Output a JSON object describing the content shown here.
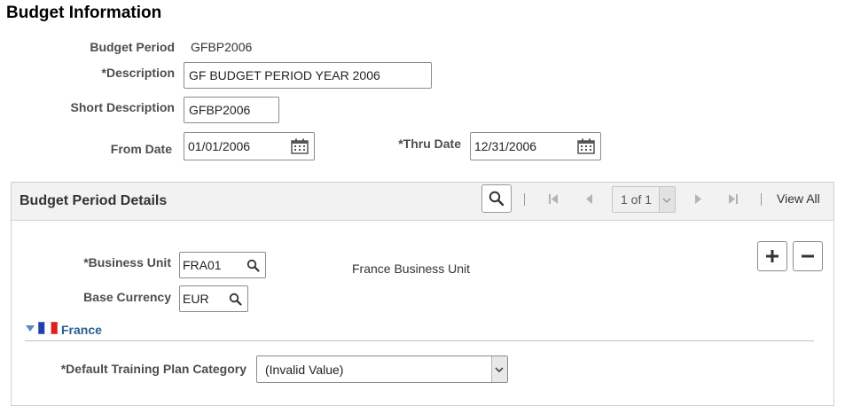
{
  "page": {
    "title": "Budget Information"
  },
  "form": {
    "budget_period_label": "Budget Period",
    "budget_period_value": "GFBP2006",
    "description_label": "*Description",
    "description_value": "GF BUDGET PERIOD YEAR 2006",
    "short_description_label": "Short Description",
    "short_description_value": "GFBP2006",
    "from_date_label": "From Date",
    "from_date_value": "01/01/2006",
    "thru_date_label": "*Thru Date",
    "thru_date_value": "12/31/2006"
  },
  "grid": {
    "title": "Budget Period Details",
    "pager_text": "1 of 1",
    "view_all": "View All",
    "business_unit_label": "*Business Unit",
    "business_unit_value": "FRA01",
    "business_unit_desc": "France Business Unit",
    "base_currency_label": "Base Currency",
    "base_currency_value": "EUR",
    "country_section": "France",
    "training_category_label": "*Default Training Plan Category",
    "training_category_value": "(Invalid Value)"
  },
  "colors": {
    "link": "#2a5d90",
    "label": "#4d4d4d",
    "header_bg": "#f2f2f2"
  }
}
